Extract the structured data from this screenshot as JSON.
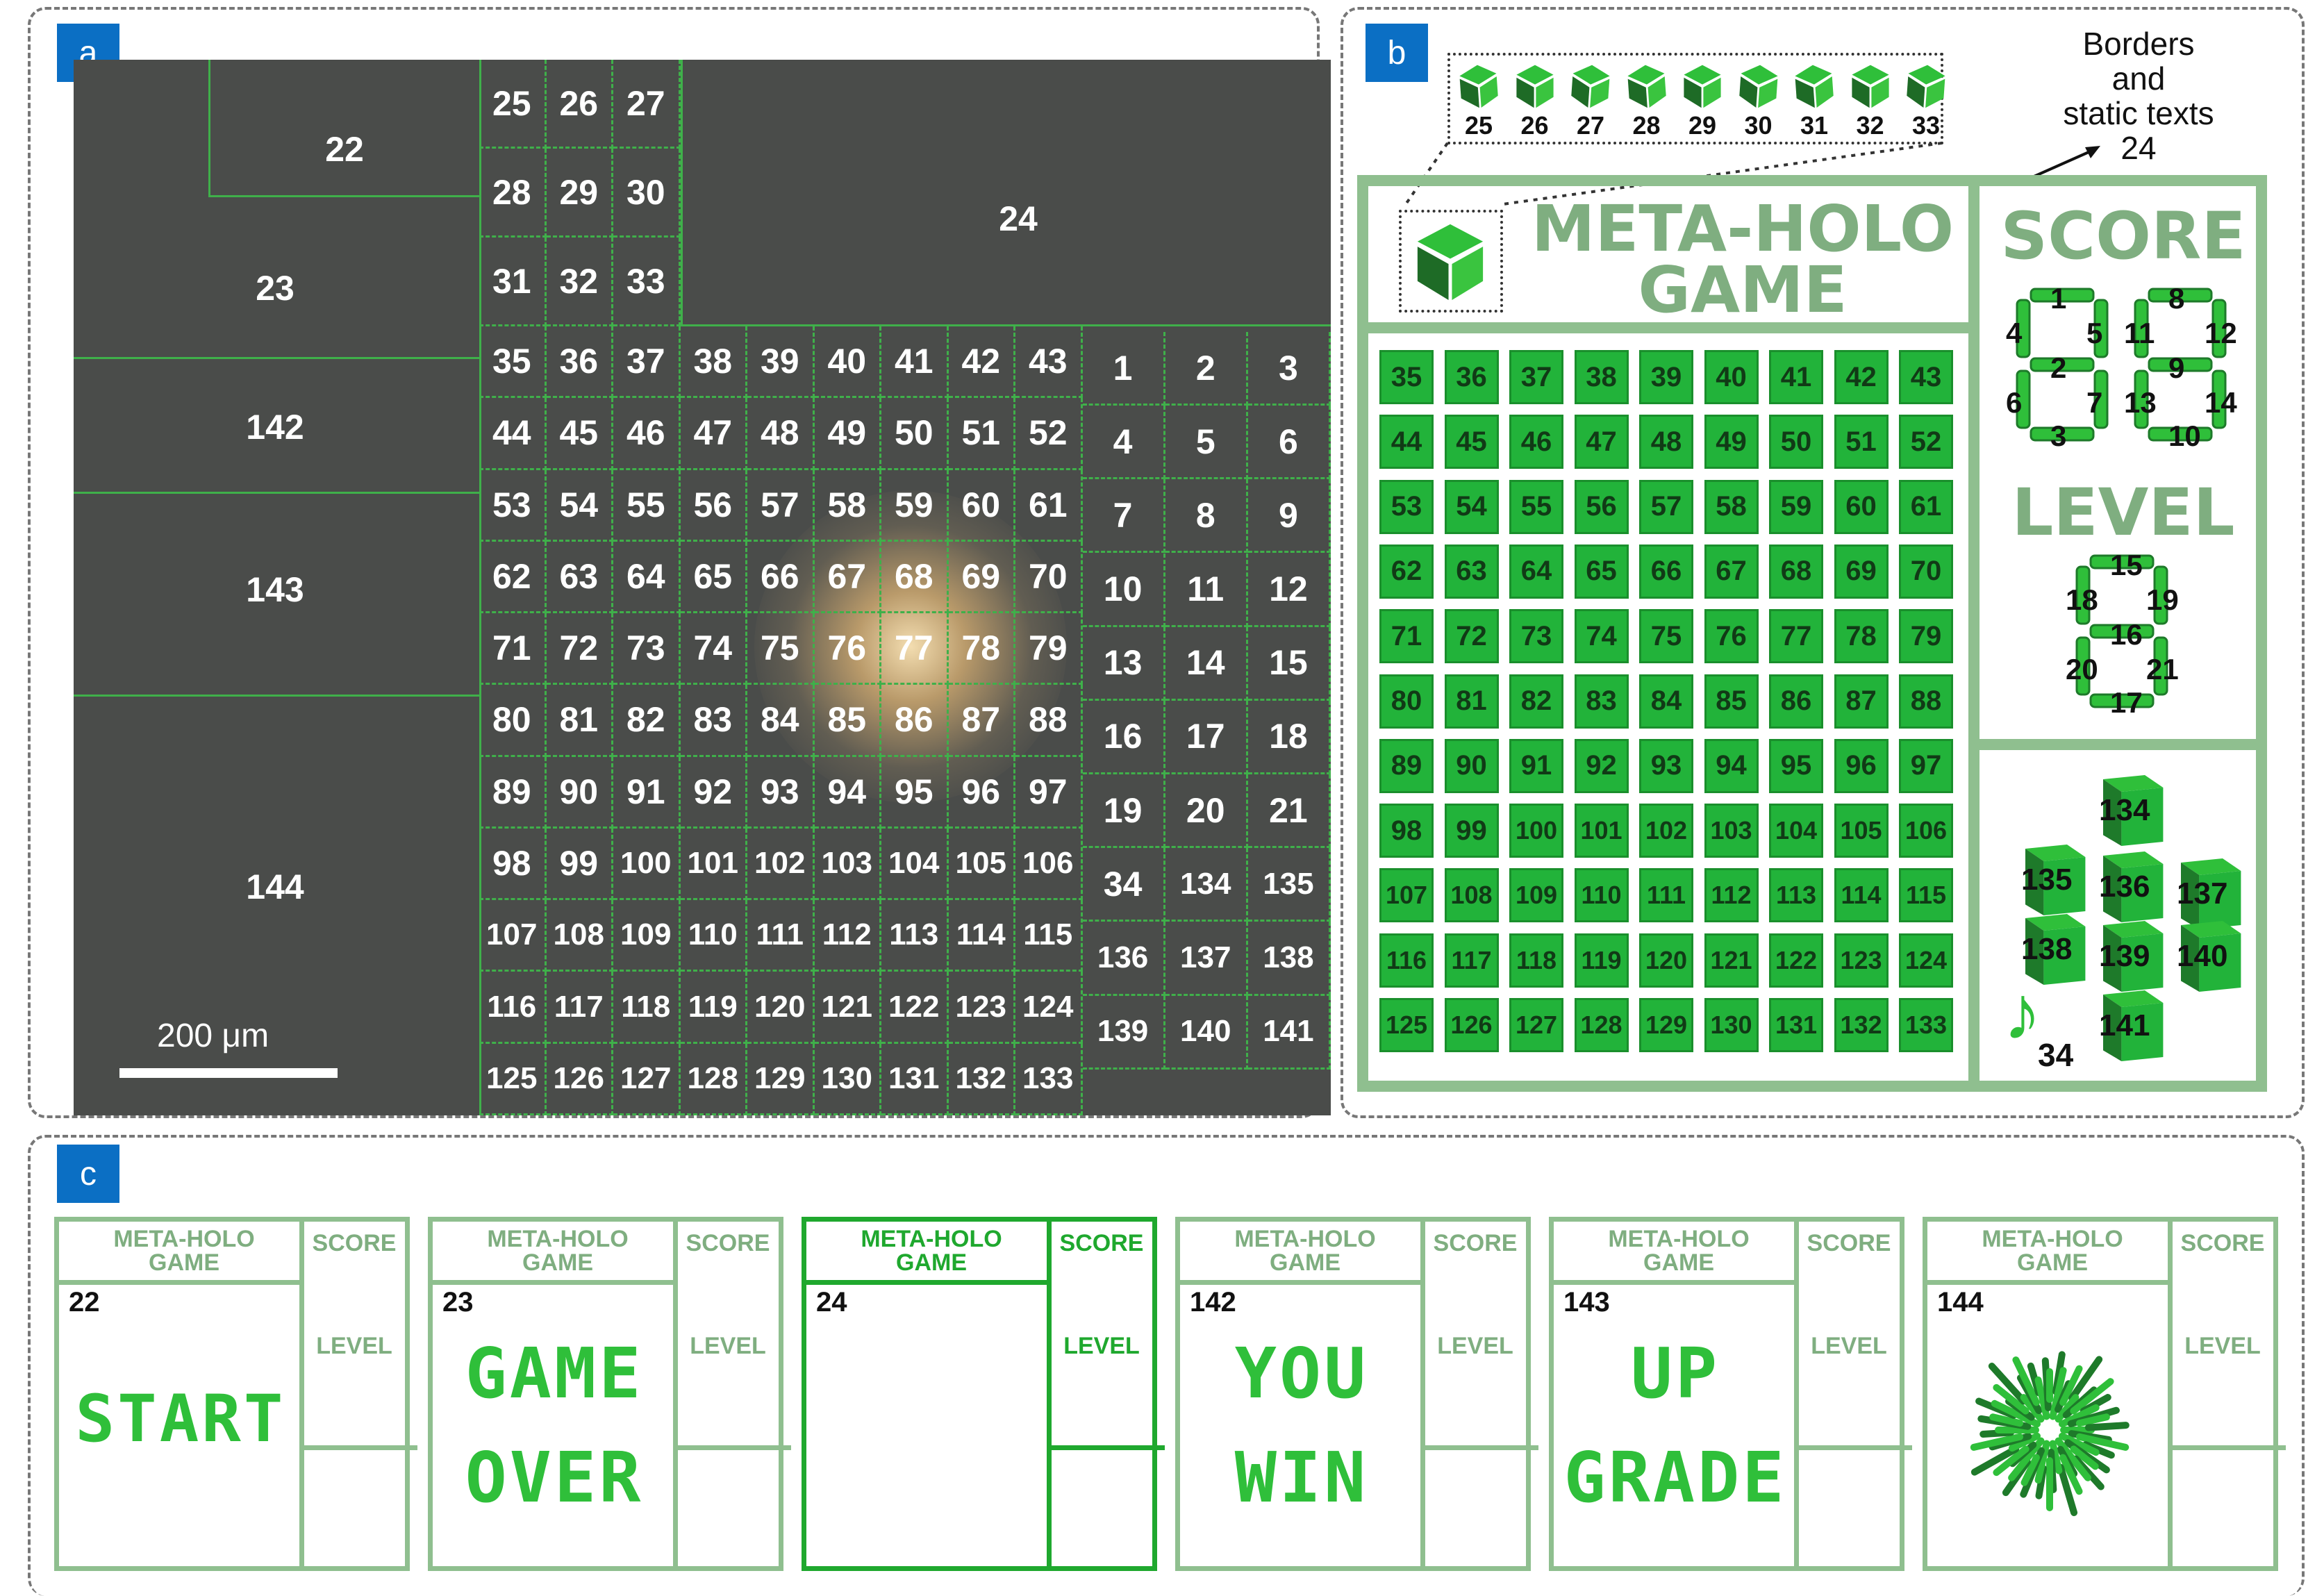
{
  "panel_a": {
    "label": "a",
    "scale_bar": "200 μm",
    "regions": [
      "22",
      "23",
      "24",
      "142",
      "143",
      "144"
    ]
  },
  "panel_b": {
    "label": "b",
    "annotation_lines": [
      "Borders",
      "and",
      "static texts"
    ],
    "annotation_num": "24",
    "logo_cube_labels": [
      "25",
      "26",
      "27",
      "28",
      "29",
      "30",
      "31",
      "32",
      "33"
    ],
    "title_line1": "META-HOLO",
    "title_line2": "GAME",
    "score": "SCORE",
    "level": "LEVEL",
    "music_label": "34",
    "digit_labels_score1": [
      "1",
      "2",
      "3",
      "4",
      "5",
      "6",
      "7"
    ],
    "digit_labels_score2": [
      "8",
      "9",
      "10",
      "11",
      "12",
      "13",
      "14"
    ],
    "digit_labels_level": [
      "15",
      "16",
      "17",
      "18",
      "19",
      "20",
      "21"
    ],
    "cubes": [
      "134",
      "135",
      "136",
      "137",
      "138",
      "139",
      "140",
      "141"
    ]
  },
  "panel_c": {
    "label": "c",
    "frames": [
      {
        "num": "22",
        "title1": "META-HOLO",
        "title2": "GAME",
        "score": "SCORE",
        "level": "LEVEL",
        "lines": [
          "START"
        ]
      },
      {
        "num": "23",
        "title1": "META-HOLO",
        "title2": "GAME",
        "score": "SCORE",
        "level": "LEVEL",
        "lines": [
          "GAME",
          "OVER"
        ]
      },
      {
        "num": "24",
        "title1": "META-HOLO",
        "title2": "GAME",
        "score": "SCORE",
        "level": "LEVEL",
        "lines": []
      },
      {
        "num": "142",
        "title1": "META-HOLO",
        "title2": "GAME",
        "score": "SCORE",
        "level": "LEVEL",
        "lines": [
          "YOU",
          "WIN"
        ]
      },
      {
        "num": "143",
        "title1": "META-HOLO",
        "title2": "GAME",
        "score": "SCORE",
        "level": "LEVEL",
        "lines": [
          "UP",
          "GRADE"
        ]
      },
      {
        "num": "144",
        "title1": "META-HOLO",
        "title2": "GAME",
        "score": "SCORE",
        "level": "LEVEL",
        "lines": []
      }
    ]
  },
  "colors": {
    "green": "#22b33a",
    "pale_green": "#8fbf8f",
    "blue_label": "#0b6fc4"
  }
}
